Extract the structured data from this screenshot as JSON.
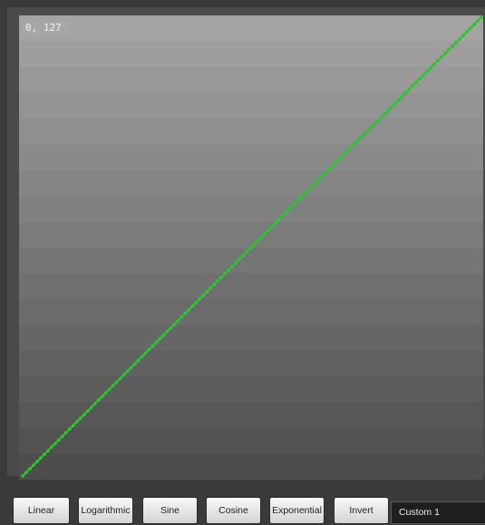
{
  "editor": {
    "coord_readout": "0, 127",
    "curve_color": "#2fc42f",
    "background_top": "#a3a3a3",
    "background_bottom": "#4d4d4d",
    "bands": 18,
    "curve": {
      "type": "linear",
      "from": [
        0,
        0
      ],
      "to": [
        127,
        127
      ],
      "points": 128
    }
  },
  "buttons": {
    "linear": "Linear",
    "logarithmic": "Logarithmic",
    "sine": "Sine",
    "cosine": "Cosine",
    "exponential": "Exponential",
    "invert": "Invert"
  },
  "preset": {
    "selected": "Custom 1"
  }
}
